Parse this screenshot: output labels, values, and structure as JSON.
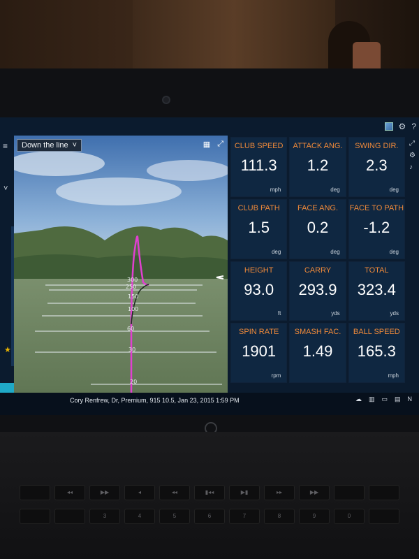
{
  "view_selector": {
    "label": "Down the line",
    "caret": "˅"
  },
  "view_icons": {
    "grid": "grid-icon",
    "expand": "expand-icon"
  },
  "yard_labels": [
    "300",
    "250",
    "150",
    "100",
    "60",
    "30",
    "20"
  ],
  "stats": [
    {
      "label": "CLUB SPEED",
      "value": "111.3",
      "unit": "mph"
    },
    {
      "label": "ATTACK ANG.",
      "value": "1.2",
      "unit": "deg"
    },
    {
      "label": "SWING DIR.",
      "value": "2.3",
      "unit": "deg"
    },
    {
      "label": "CLUB PATH",
      "value": "1.5",
      "unit": "deg"
    },
    {
      "label": "FACE ANG.",
      "value": "0.2",
      "unit": "deg"
    },
    {
      "label": "FACE TO PATH",
      "value": "-1.2",
      "unit": "deg"
    },
    {
      "label": "HEIGHT",
      "value": "93.0",
      "unit": "ft"
    },
    {
      "label": "CARRY",
      "value": "293.9",
      "unit": "yds"
    },
    {
      "label": "TOTAL",
      "value": "323.4",
      "unit": "yds"
    },
    {
      "label": "SPIN RATE",
      "value": "1901",
      "unit": "rpm"
    },
    {
      "label": "SMASH FAC.",
      "value": "1.49",
      "unit": ""
    },
    {
      "label": "BALL SPEED",
      "value": "165.3",
      "unit": "mph"
    }
  ],
  "status": {
    "caption": "Cory Renfrew, Dr, Premium, 915 10.5, Jan 23, 2015 1:59 PM",
    "n_label": "N"
  },
  "colors": {
    "accent_label": "#f08a3a",
    "tile_bg": "#0f2741",
    "trajectory": "#e040d0",
    "cyan": "#1fa9c7"
  },
  "keyboard": {
    "row1": [
      "",
      "◂◂",
      "▶▶",
      "◂",
      "◂◂",
      "▮◂◂",
      "▶▮",
      "▸▸",
      "▶▶",
      "",
      ""
    ],
    "row2": [
      "",
      "",
      "3",
      "4",
      "5",
      "6",
      "7",
      "8",
      "9",
      "0",
      ""
    ]
  }
}
